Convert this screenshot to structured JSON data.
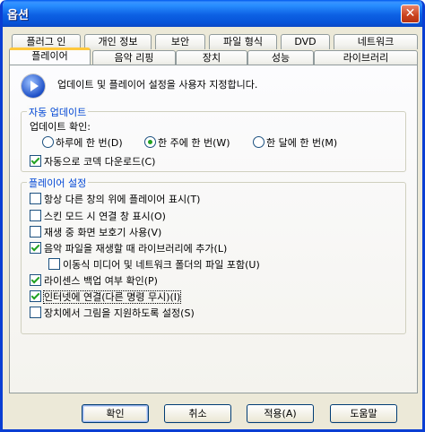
{
  "window": {
    "title": "옵션",
    "close_symbol": "✕"
  },
  "tabs_row1": [
    "플러그 인",
    "개인 정보",
    "보안",
    "파일 형식",
    "DVD",
    "네트워크"
  ],
  "tabs_row2": [
    "플레이어",
    "음악 리핑",
    "장치",
    "성능",
    "라이브러리"
  ],
  "active_tab": "플레이어",
  "header": {
    "icon": "media-player-icon",
    "text": "업데이트 및 플레이어 설정을 사용자 지정합니다."
  },
  "auto_update": {
    "title": "자동 업데이트",
    "check_label": "업데이트 확인:",
    "options": [
      "하루에 한 번(D)",
      "한 주에 한 번(W)",
      "한 달에 한 번(M)"
    ],
    "selected": "한 주에 한 번(W)",
    "codec": {
      "label": "자동으로 코덱 다운로드(C)",
      "checked": true
    }
  },
  "player_settings": {
    "title": "플레이어 설정",
    "items": [
      {
        "label": "항상 다른 창의 위에 플레이어 표시(T)",
        "checked": false
      },
      {
        "label": "스킨 모드 시 연결 창 표시(O)",
        "checked": false
      },
      {
        "label": "재생 중 화면 보호기 사용(V)",
        "checked": false
      },
      {
        "label": "음악 파일을 재생할 때 라이브러리에 추가(L)",
        "checked": true
      },
      {
        "label": "이동식 미디어 및 네트워크 폴더의 파일 포함(U)",
        "checked": false
      },
      {
        "label": "라이센스 백업 여부 확인(P)",
        "checked": true
      },
      {
        "label": "인터넷에 연결(다른 명령 무시)(I)",
        "checked": true
      },
      {
        "label": "장치에서 그림을 지원하도록 설정(S)",
        "checked": false
      }
    ]
  },
  "buttons": {
    "ok": "확인",
    "cancel": "취소",
    "apply": "적용(A)",
    "help": "도움말"
  }
}
